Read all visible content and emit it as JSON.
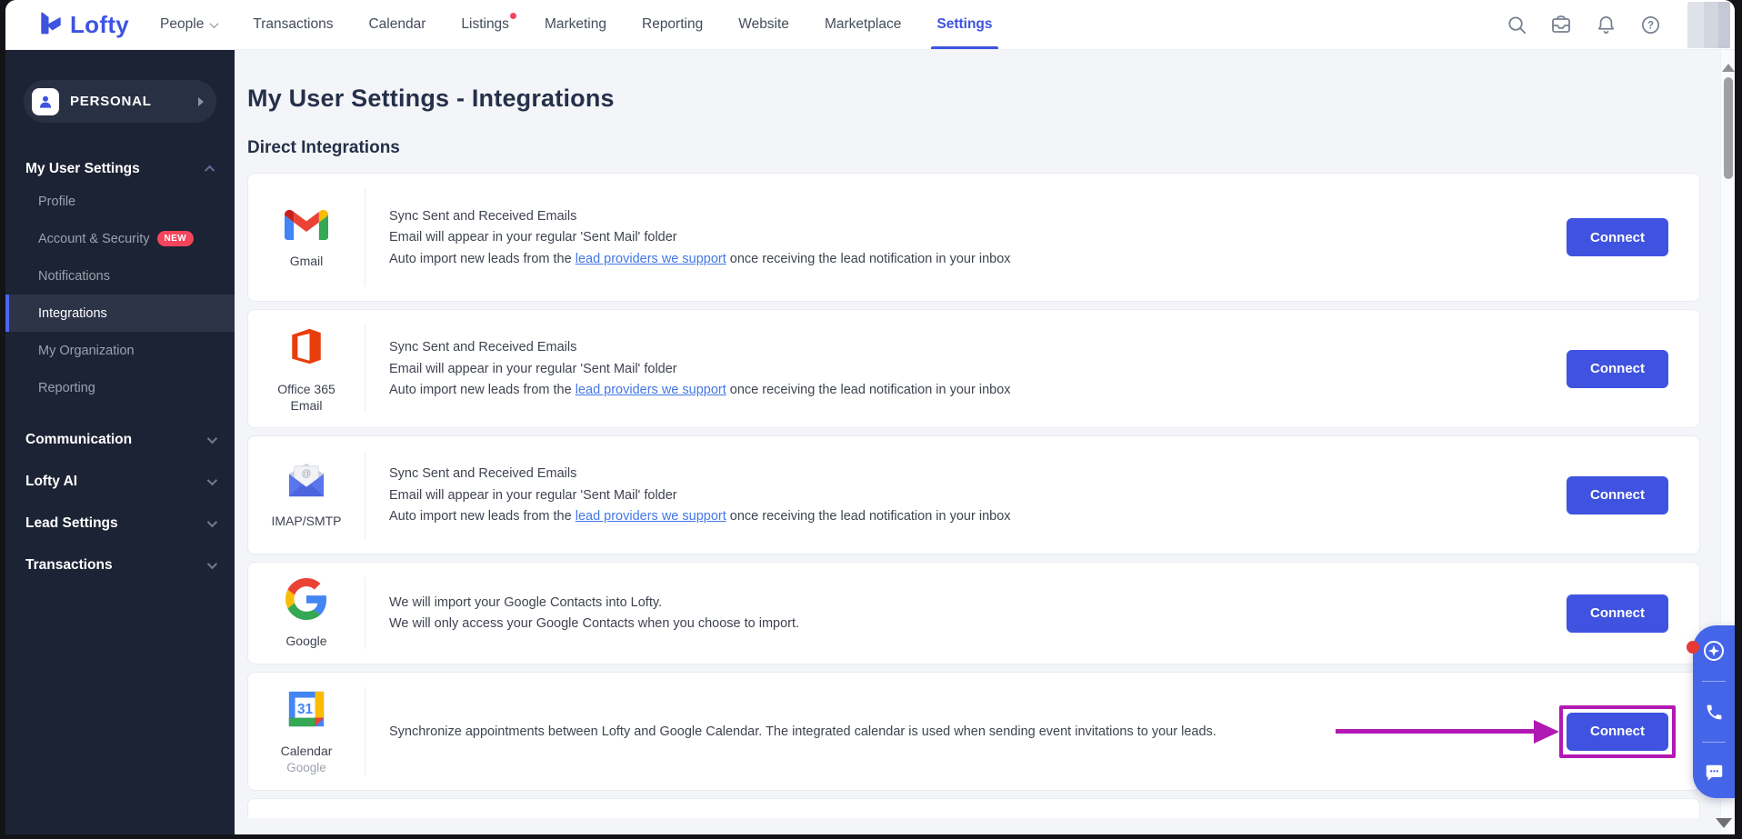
{
  "topnav": {
    "logo": "Lofty",
    "items": [
      {
        "label": "People"
      },
      {
        "label": "Transactions"
      },
      {
        "label": "Calendar"
      },
      {
        "label": "Listings"
      },
      {
        "label": "Marketing"
      },
      {
        "label": "Reporting"
      },
      {
        "label": "Website"
      },
      {
        "label": "Marketplace"
      },
      {
        "label": "Settings"
      }
    ],
    "active_item": "Settings",
    "icons": [
      "search",
      "inbox",
      "notifications",
      "help"
    ]
  },
  "sidebar": {
    "workspace": "PERSONAL",
    "group_title": "My User Settings",
    "items": [
      {
        "label": "Profile"
      },
      {
        "label": "Account & Security",
        "badge": "NEW"
      },
      {
        "label": "Notifications"
      },
      {
        "label": "Integrations",
        "active": true
      },
      {
        "label": "My Organization"
      },
      {
        "label": "Reporting"
      }
    ],
    "sections": [
      {
        "label": "Communication"
      },
      {
        "label": "Lofty AI"
      },
      {
        "label": "Lead Settings"
      },
      {
        "label": "Transactions"
      }
    ]
  },
  "main": {
    "title": "My User Settings - Integrations",
    "section_heading": "Direct Integrations",
    "integrations": [
      {
        "name": "Gmail",
        "icon": "gmail",
        "line1": "Sync Sent and Received Emails",
        "line2": "Email will appear in your regular 'Sent Mail' folder",
        "line3_prefix": "Auto import new leads from the ",
        "line3_link": "lead providers we support",
        "line3_suffix": " once receiving the lead notification in your inbox",
        "button": "Connect"
      },
      {
        "name": "Office 365 Email",
        "icon": "office365",
        "line1": "Sync Sent and Received Emails",
        "line2": "Email will appear in your regular 'Sent Mail' folder",
        "line3_prefix": "Auto import new leads from the ",
        "line3_link": "lead providers we support",
        "line3_suffix": " once receiving the lead notification in your inbox",
        "button": "Connect"
      },
      {
        "name": "IMAP/SMTP",
        "icon": "imap-smtp",
        "line1": "Sync Sent and Received Emails",
        "line2": "Email will appear in your regular 'Sent Mail' folder",
        "line3_prefix": "Auto import new leads from the ",
        "line3_link": "lead providers we support",
        "line3_suffix": " once receiving the lead notification in your inbox",
        "button": "Connect"
      },
      {
        "name": "Google",
        "icon": "google",
        "line1": "We will import your Google Contacts into Lofty.",
        "line2": "We will only access your Google Contacts when you choose to import.",
        "button": "Connect"
      },
      {
        "name": "Calendar",
        "subname": "Google",
        "icon": "google-calendar",
        "line1": "Synchronize appointments between Lofty and Google Calendar. The integrated calendar is used when sending event invitations to your leads.",
        "button": "Connect",
        "highlighted": true
      }
    ]
  },
  "widget": {
    "icons": [
      "ai-assistant",
      "phone",
      "chat"
    ]
  },
  "colors": {
    "accent_blue": "#3f53e0",
    "highlight_magenta": "#b219b4",
    "badge_red": "#f5455c",
    "sidebar_bg": "#1c2334",
    "link_blue": "#4377e6"
  }
}
